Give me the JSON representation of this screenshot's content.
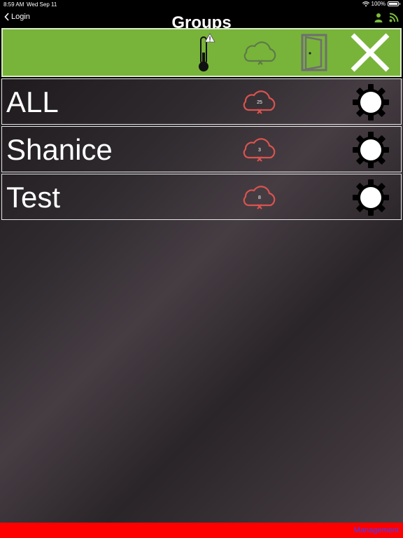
{
  "status_bar": {
    "time": "8:59 AM",
    "date": "Wed Sep 11",
    "battery_text": "100%",
    "battery_level": 1.0
  },
  "nav": {
    "back_label": "Login",
    "title": "Groups"
  },
  "colors": {
    "toolbar_green": "#78b43a",
    "footer_red": "#ff0000",
    "cloud_red": "#d9534f",
    "cloud_gray": "#6c7a5a",
    "link_blue": "#4040ff"
  },
  "toolbar": {
    "icons": [
      "thermometer-warning-icon",
      "cloud-offline-icon",
      "door-icon",
      "close-icon"
    ]
  },
  "groups": [
    {
      "name": "ALL",
      "count": "25"
    },
    {
      "name": "Shanice",
      "count": "3"
    },
    {
      "name": "Test",
      "count": "8"
    }
  ],
  "footer": {
    "management_label": "Management"
  }
}
